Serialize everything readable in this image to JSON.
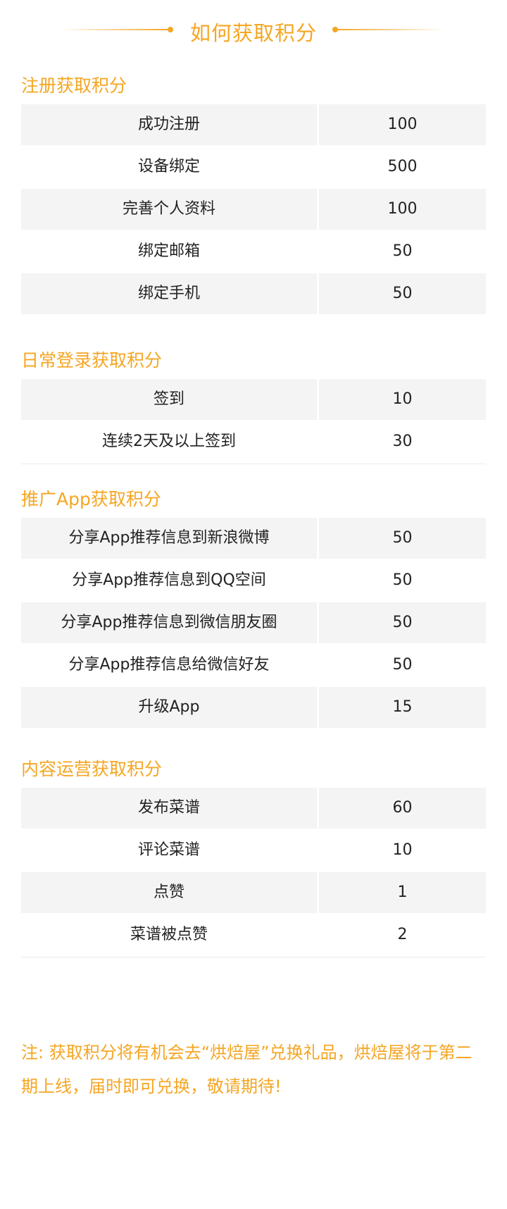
{
  "page_title": "如何获取积分",
  "sections": [
    {
      "title": "注册获取积分",
      "rows": [
        {
          "name": "成功注册",
          "points": "100"
        },
        {
          "name": "设备绑定",
          "points": "500"
        },
        {
          "name": "完善个人资料",
          "points": "100"
        },
        {
          "name": "绑定邮箱",
          "points": "50"
        },
        {
          "name": "绑定手机",
          "points": "50"
        }
      ]
    },
    {
      "title": "日常登录获取积分",
      "rows": [
        {
          "name": "签到",
          "points": "10"
        },
        {
          "name": "连续2天及以上签到",
          "points": "30"
        }
      ]
    },
    {
      "title": "推广App获取积分",
      "rows": [
        {
          "name": "分享App推荐信息到新浪微博",
          "points": "50"
        },
        {
          "name": "分享App推荐信息到QQ空间",
          "points": "50"
        },
        {
          "name": "分享App推荐信息到微信朋友圈",
          "points": "50"
        },
        {
          "name": "分享App推荐信息给微信好友",
          "points": "50"
        },
        {
          "name": "升级App",
          "points": "15"
        }
      ]
    },
    {
      "title": "内容运营获取积分",
      "rows": [
        {
          "name": "发布菜谱",
          "points": "60"
        },
        {
          "name": "评论菜谱",
          "points": "10"
        },
        {
          "name": "点赞",
          "points": "1"
        },
        {
          "name": "菜谱被点赞",
          "points": "2"
        }
      ]
    }
  ],
  "note": "注: 获取积分将有机会去“烘焙屋”兑换礼品，烘焙屋将于第二期上线，届时即可兑换，敬请期待!",
  "colors": {
    "accent": "#f5a623",
    "row_shaded": "#f4f4f4",
    "text": "#222222"
  }
}
